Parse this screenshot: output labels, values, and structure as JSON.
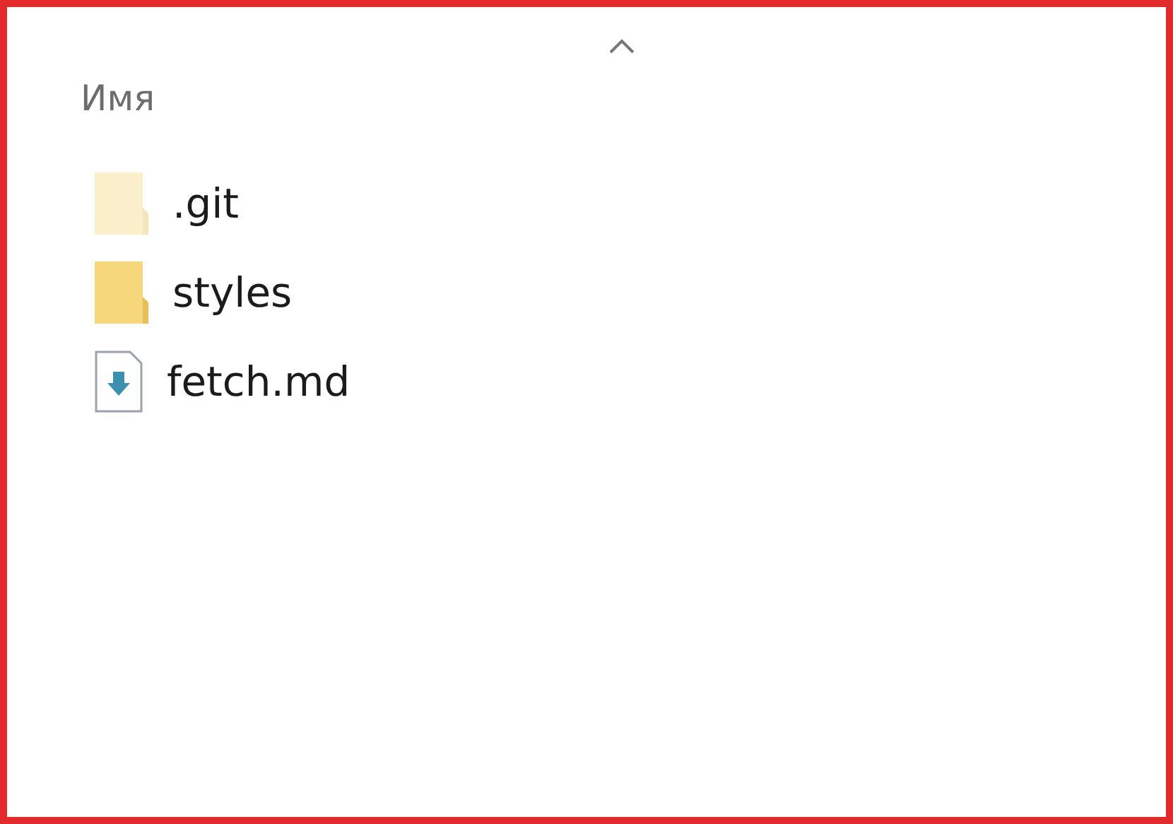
{
  "column": {
    "label": "Имя",
    "sort_ascending": true
  },
  "items": [
    {
      "name": ".git",
      "kind": "folder",
      "hidden": true
    },
    {
      "name": "styles",
      "kind": "folder",
      "hidden": false
    },
    {
      "name": "fetch.md",
      "kind": "file",
      "hidden": false
    }
  ]
}
